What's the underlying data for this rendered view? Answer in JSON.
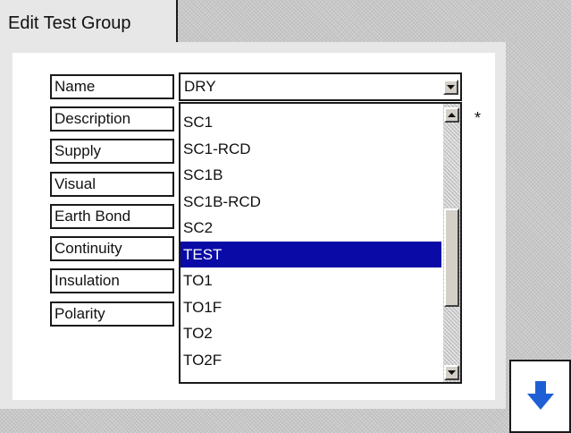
{
  "tab": {
    "title": "Edit Test Group"
  },
  "form": {
    "labels": [
      "Name",
      "Description",
      "Supply",
      "Visual",
      "Earth Bond",
      "Continuity",
      "Insulation",
      "Polarity"
    ],
    "name_value": "DRY",
    "marker": "*"
  },
  "dropdown": {
    "items": [
      "SC1",
      "SC1-RCD",
      "SC1B",
      "SC1B-RCD",
      "SC2",
      "TEST",
      "TO1",
      "TO1F",
      "TO2",
      "TO2F"
    ],
    "selected_index": 5,
    "scroll_position": 0.6
  },
  "colors": {
    "selection": "#0a0aa6",
    "down_arrow": "#1f5fd6"
  },
  "icons": {
    "combo_button": "chevron-down-icon",
    "scroll_up": "scroll-up-icon",
    "scroll_down": "scroll-down-icon",
    "next_button": "down-arrow-icon"
  }
}
